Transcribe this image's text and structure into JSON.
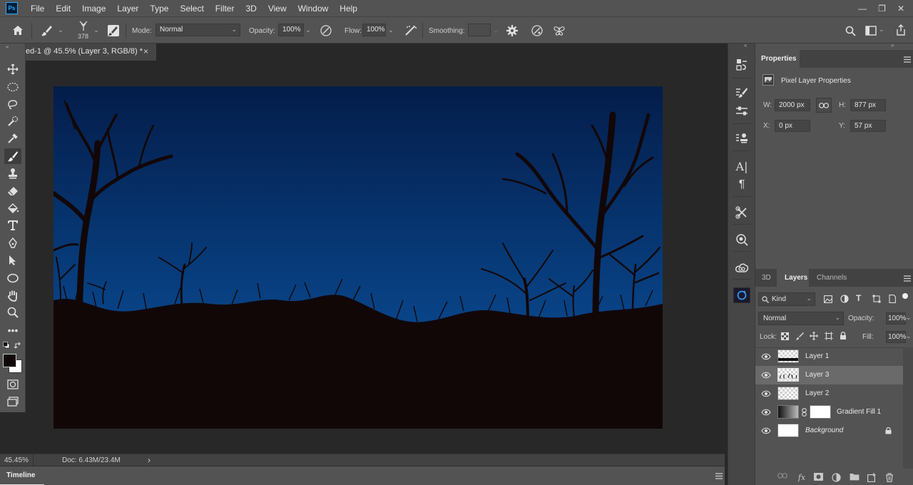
{
  "app": {
    "logo_text": "Ps"
  },
  "menu": [
    "File",
    "Edit",
    "Image",
    "Layer",
    "Type",
    "Select",
    "Filter",
    "3D",
    "View",
    "Window",
    "Help"
  ],
  "window_controls": {
    "minimize": "—",
    "restore": "❐",
    "close": "✕"
  },
  "options_bar": {
    "brush_size": "378",
    "mode_label": "Mode:",
    "mode_value": "Normal",
    "opacity_label": "Opacity:",
    "opacity_value": "100%",
    "flow_label": "Flow:",
    "flow_value": "100%",
    "smoothing_label": "Smoothing:",
    "smoothing_value": ""
  },
  "document": {
    "tab_title": "ed-1 @ 45.5% (Layer 3, RGB/8) *",
    "close_glyph": "×"
  },
  "status": {
    "zoom": "45.45%",
    "doc_info": "Doc: 6.43M/23.4M",
    "arrow": "›"
  },
  "timeline": {
    "label": "Timeline"
  },
  "properties": {
    "tab_label": "Properties",
    "section_title": "Pixel Layer Properties",
    "w_label": "W:",
    "w_value": "2000 px",
    "h_label": "H:",
    "h_value": "877 px",
    "x_label": "X:",
    "x_value": "0 px",
    "y_label": "Y:",
    "y_value": "57 px"
  },
  "layers_panel": {
    "tabs": [
      "3D",
      "Layers",
      "Channels"
    ],
    "active_tab": "Layers",
    "filter_kind": "Kind",
    "blend_mode": "Normal",
    "opacity_label": "Opacity:",
    "opacity_value": "100%",
    "lock_label": "Lock:",
    "fill_label": "Fill:",
    "fill_value": "100%",
    "layers": [
      {
        "name": "Layer 1",
        "selected": false
      },
      {
        "name": "Layer 3",
        "selected": true
      },
      {
        "name": "Layer 2",
        "selected": false
      },
      {
        "name": "Gradient Fill 1",
        "selected": false
      },
      {
        "name": "Background",
        "selected": false,
        "locked": true
      }
    ]
  },
  "colors": {
    "sky_top": "#041d4a",
    "sky_bottom": "#0a56a4",
    "ground": "#120707",
    "chrome": "#535353",
    "selected_row": "#6a6a6a"
  }
}
